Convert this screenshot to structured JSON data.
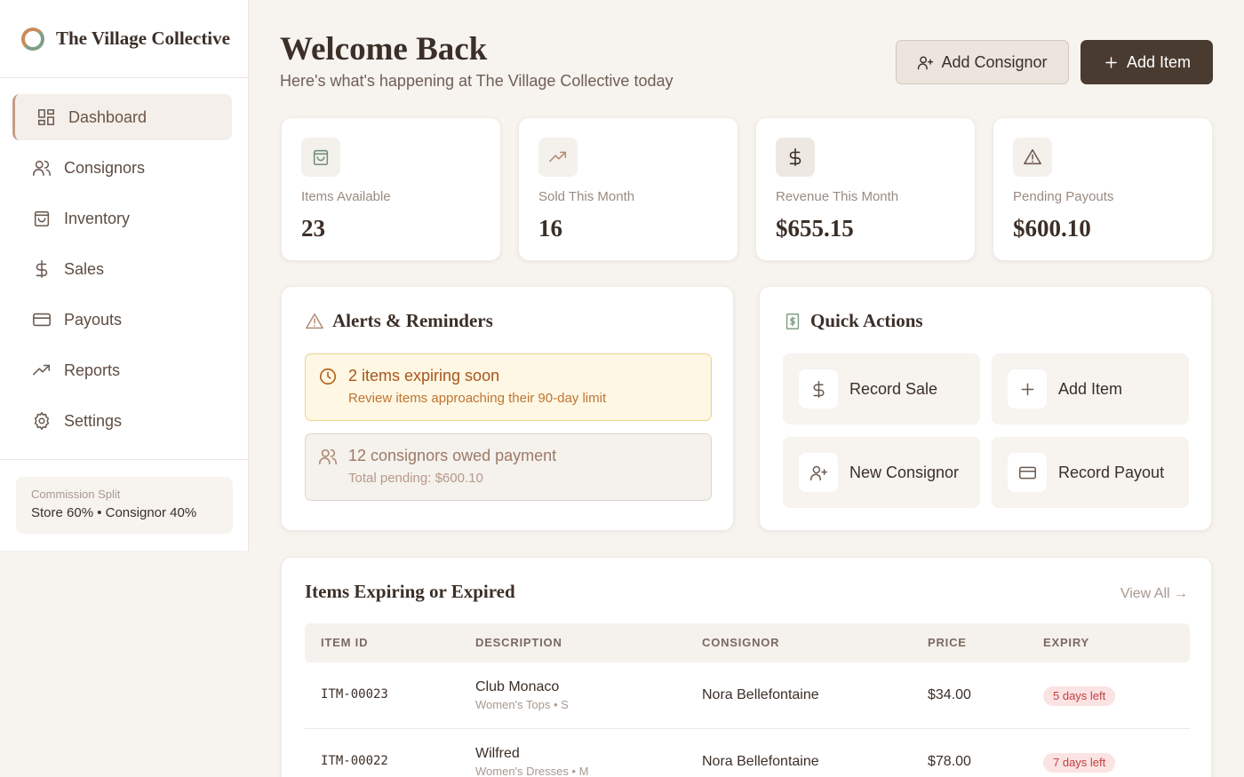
{
  "brand": {
    "name": "The Village Collective"
  },
  "sidebar": {
    "items": [
      {
        "label": "Dashboard",
        "icon": "dashboard-icon"
      },
      {
        "label": "Consignors",
        "icon": "users-icon"
      },
      {
        "label": "Inventory",
        "icon": "shopping-bag-icon"
      },
      {
        "label": "Sales",
        "icon": "dollar-icon"
      },
      {
        "label": "Payouts",
        "icon": "credit-card-icon"
      },
      {
        "label": "Reports",
        "icon": "trending-up-icon"
      },
      {
        "label": "Settings",
        "icon": "gear-icon"
      }
    ],
    "commission": {
      "label": "Commission Split",
      "value": "Store 60% • Consignor 40%"
    }
  },
  "header": {
    "title": "Welcome Back",
    "subtitle": "Here's what's happening at The Village Collective today",
    "add_consignor": "Add Consignor",
    "add_item": "Add Item"
  },
  "stats": [
    {
      "label": "Items Available",
      "value": "23",
      "icon": "shopping-bag-icon"
    },
    {
      "label": "Sold This Month",
      "value": "16",
      "icon": "trending-up-icon"
    },
    {
      "label": "Revenue This Month",
      "value": "$655.15",
      "icon": "dollar-icon"
    },
    {
      "label": "Pending Payouts",
      "value": "$600.10",
      "icon": "alert-triangle-icon"
    }
  ],
  "alerts": {
    "title": "Alerts & Reminders",
    "items": [
      {
        "title": "2 items expiring soon",
        "sub": "Review items approaching their 90-day limit"
      },
      {
        "title": "12 consignors owed payment",
        "sub": "Total pending: $600.10"
      }
    ]
  },
  "quick_actions": {
    "title": "Quick Actions",
    "items": [
      {
        "label": "Record Sale",
        "icon": "dollar-icon"
      },
      {
        "label": "Add Item",
        "icon": "plus-icon"
      },
      {
        "label": "New Consignor",
        "icon": "user-plus-icon"
      },
      {
        "label": "Record Payout",
        "icon": "credit-card-icon"
      }
    ]
  },
  "expiring": {
    "title": "Items Expiring or Expired",
    "view_all": "View All →",
    "columns": [
      "ITEM ID",
      "DESCRIPTION",
      "CONSIGNOR",
      "PRICE",
      "EXPIRY"
    ],
    "rows": [
      {
        "id": "ITM-00023",
        "name": "Club Monaco",
        "detail": "Women's Tops • S",
        "consignor": "Nora Bellefontaine",
        "price": "$34.00",
        "expiry": "5 days left"
      },
      {
        "id": "ITM-00022",
        "name": "Wilfred",
        "detail": "Women's Dresses • M",
        "consignor": "Nora Bellefontaine",
        "price": "$78.00",
        "expiry": "7 days left"
      }
    ]
  },
  "colors": {
    "background": "#f7f3ef",
    "primary_button": "#4a3b31",
    "warning_bg": "#fdf7e3",
    "badge_bg": "#fbe3e3",
    "badge_text": "#c24040"
  }
}
